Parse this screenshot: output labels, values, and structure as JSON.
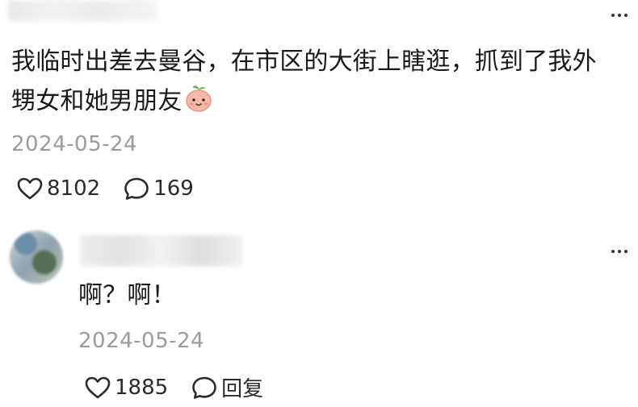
{
  "main_comment": {
    "text_line1": "我临时出差去曼谷，在市区的大街上瞎逛，抓到了我外",
    "text_line2": "甥女和她男朋友",
    "emoji": "peach-face-emoji",
    "date": "2024-05-24",
    "likes": "8102",
    "comments": "169"
  },
  "reply_comment": {
    "text": "啊？啊！",
    "date": "2024-05-24",
    "likes": "1885",
    "reply_label": "回复"
  },
  "icons": {
    "more": "more-icon",
    "like": "heart-icon",
    "comment": "comment-bubble-icon",
    "avatar": "avatar"
  },
  "colors": {
    "text": "#1a1a1a",
    "meta": "#9b9b9b",
    "background": "#ffffff"
  }
}
